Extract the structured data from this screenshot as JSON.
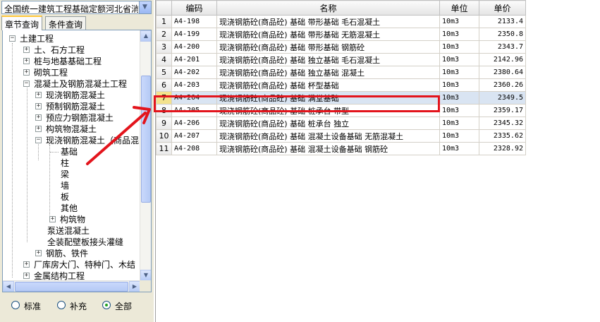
{
  "combo": {
    "value": "全国统一建筑工程基础定额河北省消"
  },
  "tabs": [
    {
      "label": "章节查询"
    },
    {
      "label": "条件查询"
    }
  ],
  "tree": {
    "root": "土建工程",
    "level1": [
      "土、石方工程",
      "桩与地基基础工程",
      "砌筑工程",
      "混凝土及钢筋混凝土工程"
    ],
    "level2": [
      "现浇钢筋混凝土",
      "预制钢筋混凝土",
      "预应力钢筋混凝土",
      "构筑物混凝土",
      "现浇钢筋混凝土（商品混"
    ],
    "level3": [
      "基础",
      "柱",
      "梁",
      "墙",
      "板",
      "其他",
      "构筑物"
    ],
    "level2b": [
      "泵送混凝土",
      "全装配壁板接头灌缝",
      "钢筋、铁件"
    ],
    "level1b": [
      "厂库房大门、特种门、木结",
      "金属结构工程"
    ]
  },
  "radios": {
    "options": [
      "标准",
      "补充",
      "全部"
    ],
    "selected": "全部"
  },
  "grid": {
    "headers": {
      "code": "编码",
      "name": "名称",
      "unit": "单位",
      "price": "单价"
    },
    "rows": [
      {
        "n": "1",
        "code": "A4-198",
        "name": "现浇钢筋砼(商品砼) 基础 带形基础 毛石混凝土",
        "unit": "10m3",
        "price": "2133.4"
      },
      {
        "n": "2",
        "code": "A4-199",
        "name": "现浇钢筋砼(商品砼) 基础 带形基础 无筋混凝土",
        "unit": "10m3",
        "price": "2350.8"
      },
      {
        "n": "3",
        "code": "A4-200",
        "name": "现浇钢筋砼(商品砼) 基础 带形基础 钢筋砼",
        "unit": "10m3",
        "price": "2343.7"
      },
      {
        "n": "4",
        "code": "A4-201",
        "name": "现浇钢筋砼(商品砼) 基础 独立基础 毛石混凝土",
        "unit": "10m3",
        "price": "2142.96"
      },
      {
        "n": "5",
        "code": "A4-202",
        "name": "现浇钢筋砼(商品砼) 基础 独立基础 混凝土",
        "unit": "10m3",
        "price": "2380.64"
      },
      {
        "n": "6",
        "code": "A4-203",
        "name": "现浇钢筋砼(商品砼) 基础 杯型基础",
        "unit": "10m3",
        "price": "2360.26"
      },
      {
        "n": "7",
        "code": "A4-204",
        "name": "现浇钢筋砼(商品砼) 基础 满堂基础",
        "unit": "10m3",
        "price": "2349.5"
      },
      {
        "n": "8",
        "code": "A4-205",
        "name": "现浇钢筋砼(商品砼) 基础 桩承台 带型",
        "unit": "10m3",
        "price": "2359.17"
      },
      {
        "n": "9",
        "code": "A4-206",
        "name": "现浇钢筋砼(商品砼) 基础 桩承台 独立",
        "unit": "10m3",
        "price": "2345.32"
      },
      {
        "n": "10",
        "code": "A4-207",
        "name": "现浇钢筋砼(商品砼) 基础 混凝土设备基础 无筋混凝土",
        "unit": "10m3",
        "price": "2335.62"
      },
      {
        "n": "11",
        "code": "A4-208",
        "name": "现浇钢筋砼(商品砼) 基础 混凝土设备基础 钢筋砼",
        "unit": "10m3",
        "price": "2328.92"
      }
    ],
    "selected_row": 7
  },
  "colors": {
    "highlight": "#e3141c",
    "selected_row": "#d9e4f2"
  }
}
